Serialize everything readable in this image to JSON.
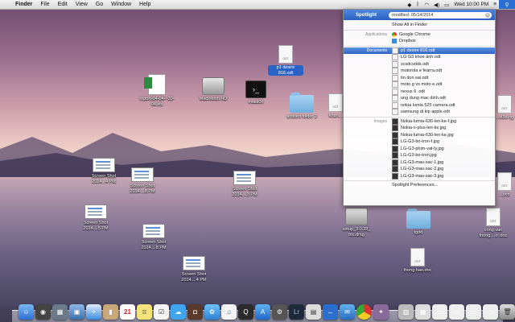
{
  "menubar": {
    "app": "Finder",
    "items": [
      "File",
      "Edit",
      "View",
      "Go",
      "Window",
      "Help"
    ],
    "clock": "Wed 10:00 PM"
  },
  "desktop": {
    "icons": [
      {
        "label": "report-04-04-~30-04.xls"
      },
      {
        "label": "Macintosh HD"
      },
      {
        "label": "evasi0n"
      },
      {
        "label": "p1 desire 816.odt"
      },
      {
        "label": "untitled folder 2"
      },
      {
        "label": "khun..."
      },
      {
        "label": "Screen Shot 2014...4 PM"
      },
      {
        "label": "Screen Shot 2014....8 PM"
      },
      {
        "label": "Screen Shot 2014....3 PM"
      },
      {
        "label": "Screen Shot 2014....5 PM"
      },
      {
        "label": "Screen Shot 2014....8 PM"
      },
      {
        "label": "Screen Shot 2014....4 PM"
      },
      {
        "label": "setup_3.0.28_ htc.dmg"
      },
      {
        "label": "tgdd"
      },
      {
        "label": "cong van thong....o .doc"
      },
      {
        "label": "thong bao.doc"
      },
      {
        "label": "...vl3d ng"
      },
      {
        "label": "...yen"
      }
    ]
  },
  "spotlight": {
    "label": "Spotlight",
    "query": "modified: 05/14/2014",
    "show_all": "Show All in Finder",
    "categories": {
      "applications": "Applications",
      "documents": "Documents",
      "images": "Images"
    },
    "applications": [
      "Google Chrome",
      "Dropbox"
    ],
    "documents": [
      "p1 desire 816.odt",
      "LG G3 khoe ảnh.odt",
      "scsdcsdds.odt",
      "motorola e fearra.odt",
      "tin don sai.odt",
      "moto g vs moto e.odt",
      "nexus 6 .odt",
      "ung dung mac dinh.odt",
      "nokia lumia 525 camera.odt",
      "samsung di kip apple.odt"
    ],
    "images": [
      "Nokia-lumia-630-len-ke-f.jpg",
      "Nokia-x-plus-len-ke.jpg",
      "Nokia-lumia-630-len-ke.jpg",
      "LG-G3-bo-tron-f.jpg",
      "LG-G3-phim-vat-ly.jpg",
      "LG-G3-bo-tron.jpg",
      "LG-G3-mau-sac-1.jpg",
      "LG-G3-mau-sac-2.jpg",
      "LG-G3-mau-sac-3.jpg"
    ],
    "preferences": "Spotlight Preferences..."
  },
  "dock": {
    "calendar_day": "21",
    "lr": "Lr"
  }
}
